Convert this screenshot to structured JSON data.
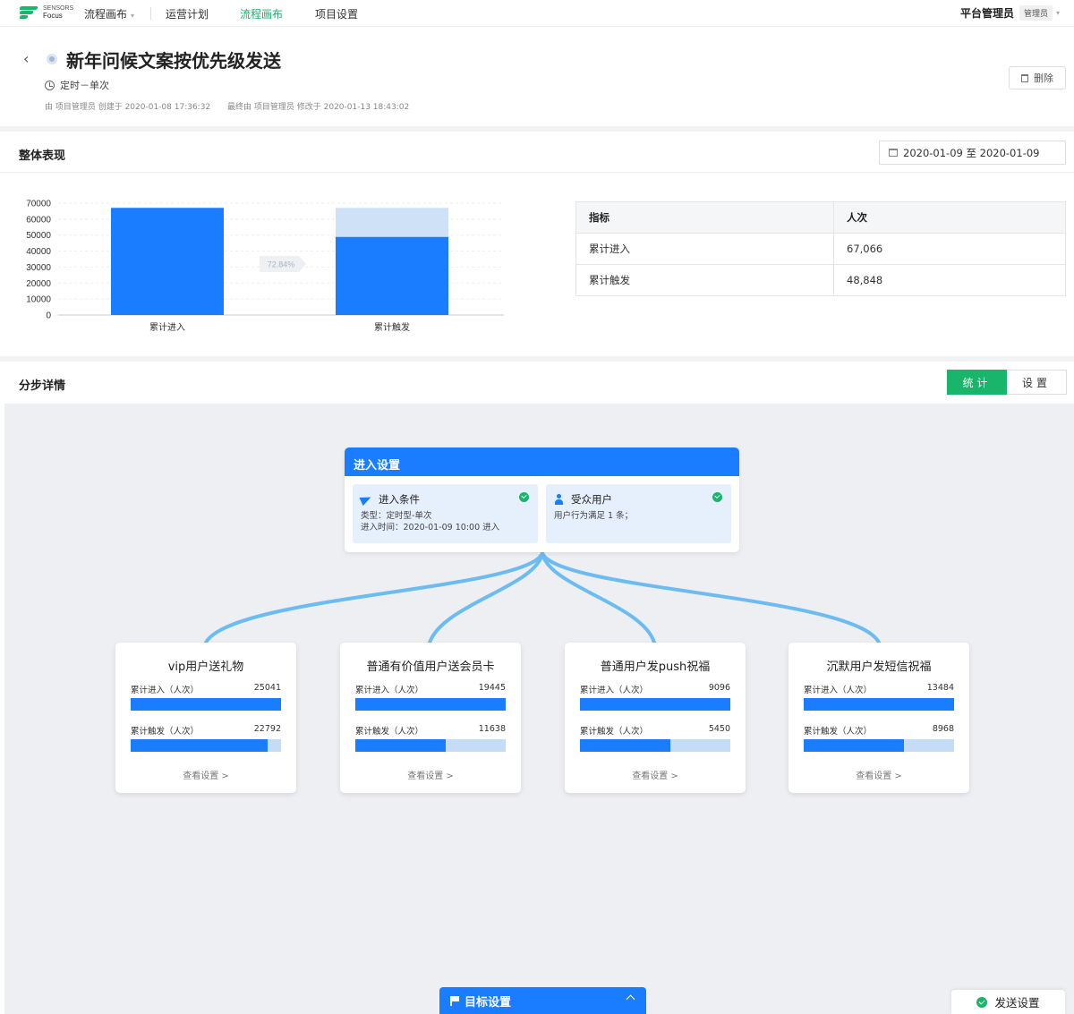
{
  "brand": {
    "line1": "SENSORS",
    "line2": "Focus",
    "accent": "#18b56a"
  },
  "topnav": {
    "items": [
      {
        "label": "流程画布",
        "dropdown": true,
        "active": false
      },
      {
        "label": "运营计划",
        "active": false
      },
      {
        "label": "流程画布",
        "active": true
      },
      {
        "label": "项目设置",
        "active": false
      }
    ],
    "user": "平台管理员",
    "role": "管理员"
  },
  "header": {
    "title": "新年问候文案按优先级发送",
    "schedule": "定时－单次",
    "created": "由 项目管理员 创建于 2020-01-08 17:36:32",
    "modified": "最终由 项目管理员 修改于 2020-01-13 18:43:02",
    "delete_label": "删除"
  },
  "overview": {
    "title": "整体表现",
    "date_range": "2020-01-09 至 2020-01-09",
    "conversion_label": "72.84%",
    "table": {
      "headers": [
        "指标",
        "人次"
      ],
      "rows": [
        [
          "累计进入",
          "67,066"
        ],
        [
          "累计触发",
          "48,848"
        ]
      ]
    }
  },
  "chart_data": {
    "type": "bar",
    "categories": [
      "累计进入",
      "累计触发"
    ],
    "series": [
      {
        "values": [
          67066,
          48848
        ]
      }
    ],
    "yticks": [
      0,
      10000,
      20000,
      30000,
      40000,
      50000,
      60000,
      70000
    ],
    "ylim": [
      0,
      70000
    ],
    "grid": true,
    "colors": {
      "bar": "#1a7cff",
      "ghost": "#cfe1f7"
    }
  },
  "steps": {
    "title": "分步详情",
    "tabs": [
      "统计",
      "设置"
    ],
    "entry": {
      "title": "进入设置",
      "condition": {
        "title": "进入条件",
        "line1": "类型：定时型-单次",
        "line2": "进入时间：2020-01-09 10:00 进入"
      },
      "audience": {
        "title": "受众用户",
        "line1": "用户行为满足 1 条；"
      }
    },
    "branches": [
      {
        "title": "vip用户送礼物",
        "entered_label": "累计进入（人次）",
        "entered": 25041,
        "triggered_label": "累计触发（人次）",
        "triggered": 22792,
        "link": "查看设置"
      },
      {
        "title": "普通有价值用户送会员卡",
        "entered_label": "累计进入（人次）",
        "entered": 19445,
        "triggered_label": "累计触发（人次）",
        "triggered": 11638,
        "link": "查看设置"
      },
      {
        "title": "普通用户发push祝福",
        "entered_label": "累计进入（人次）",
        "entered": 9096,
        "triggered_label": "累计触发（人次）",
        "triggered": 5450,
        "link": "查看设置"
      },
      {
        "title": "沉默用户发短信祝福",
        "entered_label": "累计进入（人次）",
        "entered": 13484,
        "triggered_label": "累计触发（人次）",
        "triggered": 8968,
        "link": "查看设置"
      }
    ],
    "goal_label": "目标设置",
    "send_label": "发送设置"
  }
}
